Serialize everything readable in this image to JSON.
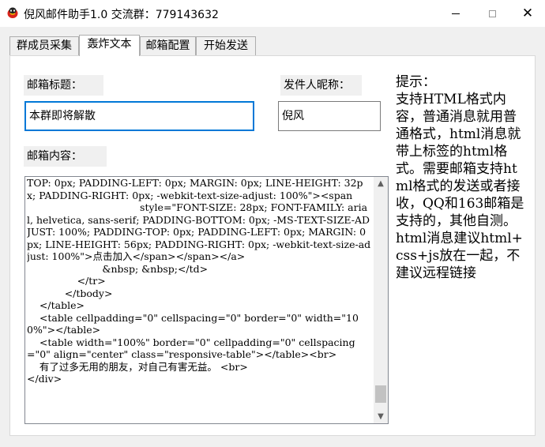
{
  "window": {
    "title": "倪风邮件助手1.0 交流群：779143632",
    "icon": "app-logo-icon",
    "minimize_icon": "minimize-icon",
    "maximize_icon": "maximize-icon",
    "close_icon": "close-icon",
    "close_glyph": "✕"
  },
  "tabs": [
    {
      "label": "群成员采集"
    },
    {
      "label": "轰炸文本"
    },
    {
      "label": "邮箱配置"
    },
    {
      "label": "开始发送"
    }
  ],
  "active_tab": 1,
  "form": {
    "subject_label": "邮箱标题：",
    "subject_value": "本群即将解散",
    "sender_label": "发件人昵称：",
    "sender_value": "倪风",
    "content_label": "邮箱内容：",
    "content_value": "TOP: 0px; PADDING-LEFT: 0px; MARGIN: 0px; LINE-HEIGHT: 32px; PADDING-RIGHT: 0px; -webkit-text-size-adjust: 100%\"><span\n                                    style=\"FONT-SIZE: 28px; FONT-FAMILY: arial, helvetica, sans-serif; PADDING-BOTTOM: 0px; -MS-TEXT-SIZE-ADJUST: 100%; PADDING-TOP: 0px; PADDING-LEFT: 0px; MARGIN: 0px; LINE-HEIGHT: 56px; PADDING-RIGHT: 0px; -webkit-text-size-adjust: 100%\">点击加入</span></span></a>\n                        &nbsp; &nbsp;</td>\n                </tr>\n            </tbody>\n    </table>\n    <table cellpadding=\"0\" cellspacing=\"0\" border=\"0\" width=\"100%\"></table>\n    <table width=\"100%\" border=\"0\" cellpadding=\"0\" cellspacing=\"0\" align=\"center\" class=\"responsive-table\"></table><br>\n    有了过多无用的朋友，对自己有害无益。 <br>\n</div>"
  },
  "scrollbar": {
    "up_icon": "scroll-up-arrow-icon",
    "down_icon": "scroll-down-arrow-icon",
    "up_glyph": "▲",
    "down_glyph": "▼"
  },
  "hint": "提示：\n支持HTML格式内容，普通消息就用普通格式，html消息就带上标签的html格式。需要邮箱支持html格式的发送或者接收，QQ和163邮箱是支持的，其他自测。\nhtml消息建议html+css+js放在一起，不建议远程链接",
  "colors": {
    "focus_border": "#0078d7",
    "window_bg": "#f0f0f0",
    "icon_red": "#d9251c"
  }
}
